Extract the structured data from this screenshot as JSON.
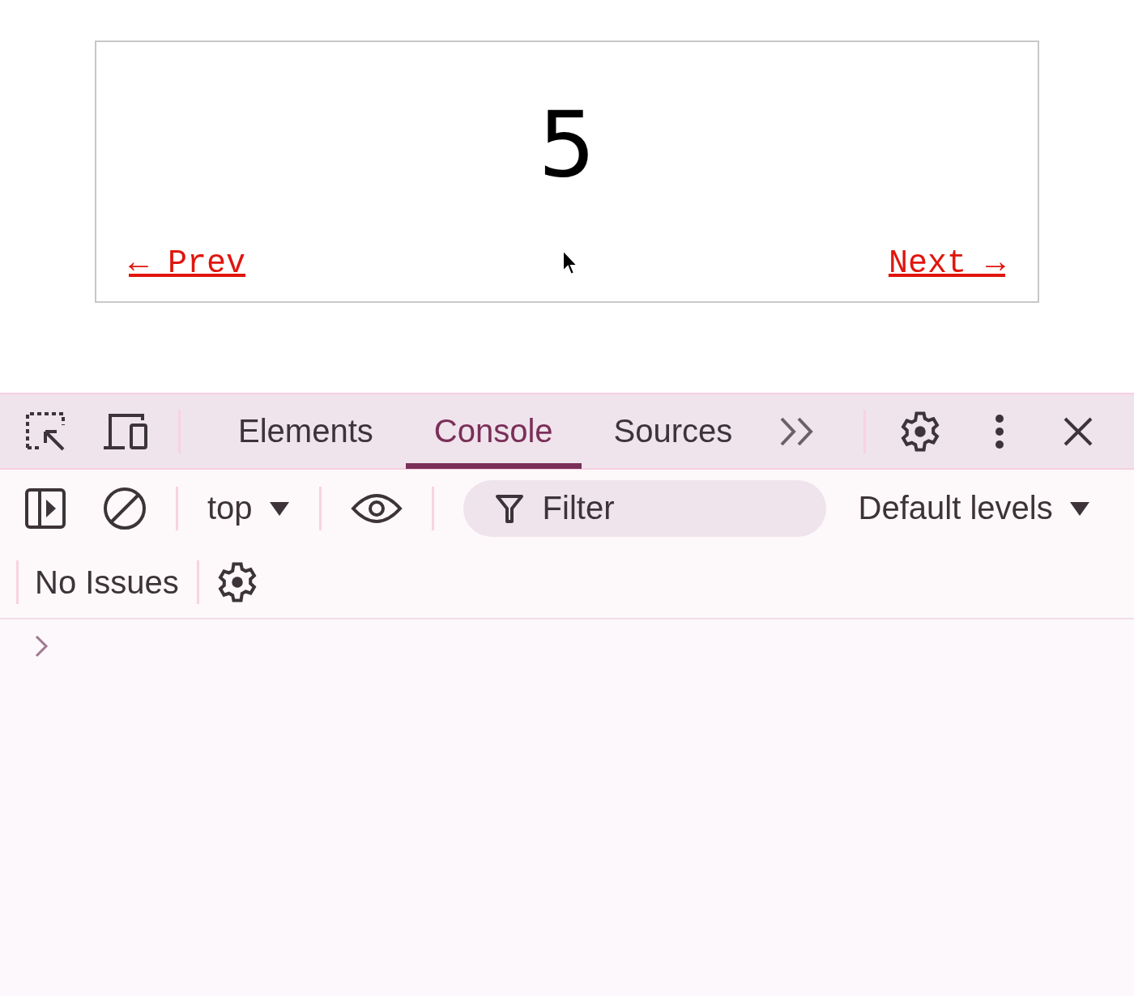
{
  "page": {
    "counter": "5",
    "prev_link": "← Prev",
    "next_link": "Next →"
  },
  "devtools": {
    "tabs": [
      {
        "label": "Elements",
        "selected": false
      },
      {
        "label": "Console",
        "selected": true
      },
      {
        "label": "Sources",
        "selected": false
      }
    ],
    "context": "top",
    "filter": {
      "placeholder": "Filter"
    },
    "levels": "Default levels",
    "issues": "No Issues"
  }
}
